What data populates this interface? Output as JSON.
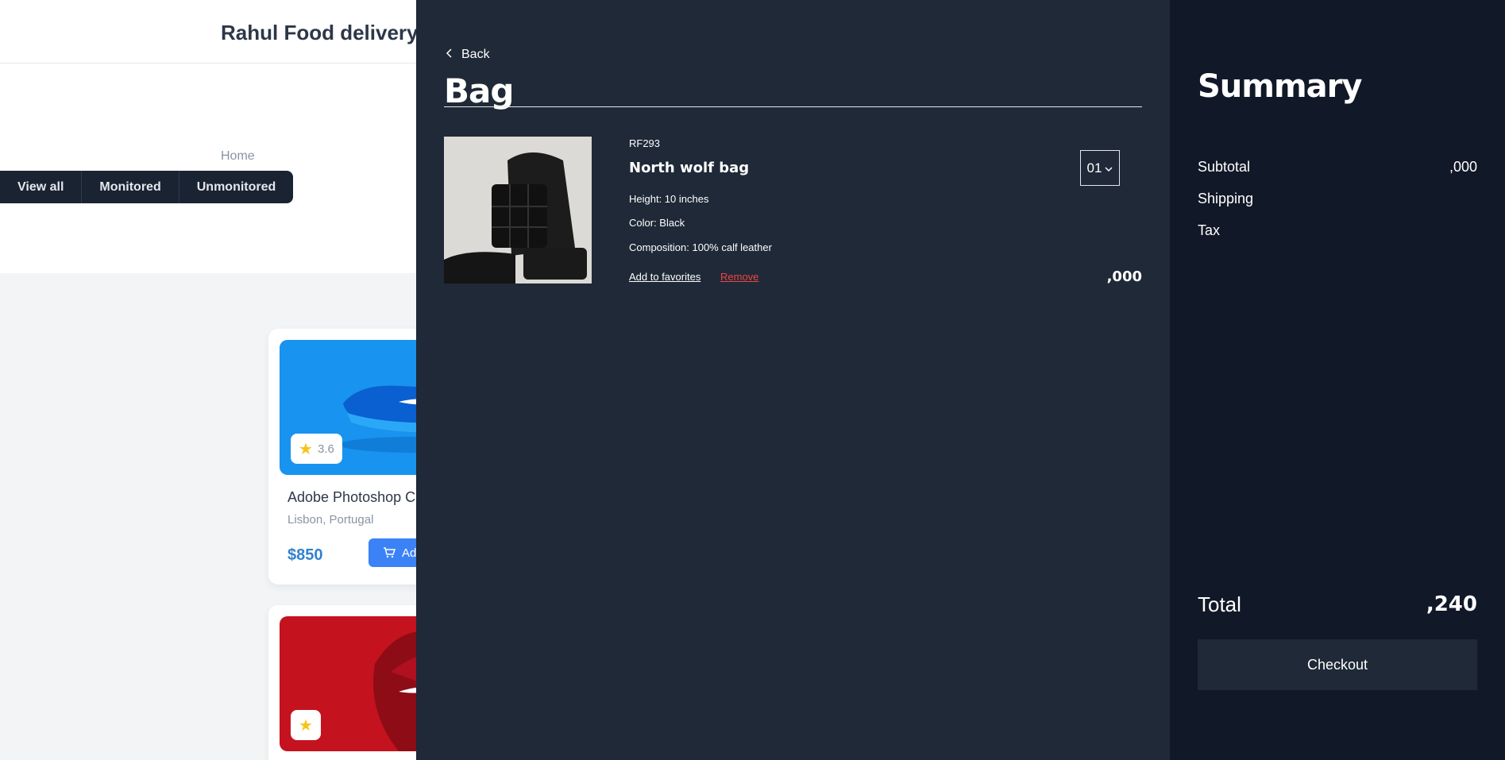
{
  "background": {
    "title": "Rahul Food delivery",
    "nav_home": "Home",
    "filters": [
      "View all",
      "Monitored",
      "Unmonitored"
    ],
    "cards": [
      {
        "name": "Adobe Photoshop CC",
        "location": "Lisbon, Portugal",
        "price": "$850",
        "rating": "3.6",
        "add_label": "Add to cart"
      },
      {
        "rating": ""
      }
    ]
  },
  "bag": {
    "back_label": "Back",
    "title": "Bag",
    "item": {
      "sku": "RF293",
      "name": "North wolf bag",
      "height": "Height: 10 inches",
      "color": "Color: Black",
      "composition": "Composition: 100% calf leather",
      "quantity": "01",
      "favorites_label": "Add to favorites",
      "remove_label": "Remove",
      "price": ",000"
    }
  },
  "summary": {
    "title": "Summary",
    "subtotal_label": "Subtotal",
    "subtotal_value": ",000",
    "shipping_label": "Shipping",
    "tax_label": "Tax",
    "total_label": "Total",
    "total_value": ",240",
    "checkout_label": "Checkout"
  },
  "colors": {
    "bag_bg": "#1f2937",
    "summary_bg": "#111827",
    "remove": "#ef4444",
    "price_blue": "#3182ce"
  }
}
